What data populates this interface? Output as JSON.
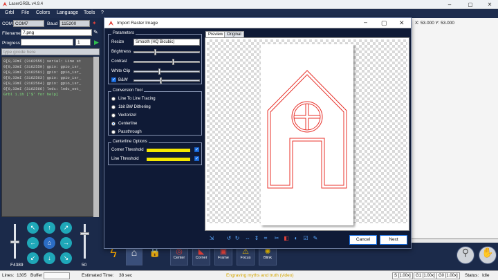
{
  "app": {
    "title": "LaserGRBL v4.9.4"
  },
  "window_buttons": {
    "minimize": "–",
    "maximize": "▢",
    "close": "✕"
  },
  "menu": [
    "Grbl",
    "File",
    "Colors",
    "Language",
    "Tools",
    "?"
  ],
  "connection": {
    "com_label": "COM",
    "com_value": "COM7",
    "baud_label": "Baud",
    "baud_value": "115200"
  },
  "file": {
    "filename_label": "Filename",
    "filename_value": "7.png",
    "progress_label": "Progress",
    "progress_value": "1"
  },
  "gcode_placeholder": "type gcode here",
  "console_lines": [
    "0[0,32mI (3162555) serial: Line st",
    "0[0,33mI (3162559) gpio: gpio_isr_",
    "0[0,33mI (3162561) gpio: gpio_isr_",
    "0[0,33mI (3162563) gpio: gpio_isr_",
    "0[0,33mI (3162564) gpio: gpio_isr_",
    "0[0,33mI (3162566) ledc: ledc_set_",
    "Grbl 1.1h ['$' for help]"
  ],
  "jog": {
    "speed_label": "F4389",
    "step_label": "50"
  },
  "coords": "X: 53.000 Y: 53.000",
  "dialog": {
    "title": "Import Raster Image",
    "tabs": [
      "Preview",
      "Original"
    ],
    "parameters": {
      "title": "Parameters",
      "resize_label": "Resize",
      "resize_value": "Smooth (HQ Bicubic)",
      "brightness_label": "Brightness",
      "brightness_level": 0.33,
      "contrast_label": "Contrast",
      "contrast_level": 0.6,
      "whiteclip_label": "White Clip",
      "whiteclip_level": 0.4,
      "bw_label": "B&W",
      "bw_level": 0.42
    },
    "conversion": {
      "title": "Conversion Tool",
      "options": [
        "Line To Line Tracing",
        "1bit BW Dithering",
        "Vectorize!",
        "Centerline",
        "Passthrough"
      ],
      "selected": 3
    },
    "centerline": {
      "title": "Centerline Options",
      "corner_label": "Corner Threshold",
      "corner_level": 0.95,
      "line_label": "Line Threshold",
      "line_level": 0.95
    },
    "cancel_label": "Cancel",
    "next_label": "Next",
    "line_color": "#e8312a"
  },
  "tools": [
    {
      "icon": "lightning-icon",
      "label": ""
    },
    {
      "icon": "home-icon",
      "label": ""
    },
    {
      "icon": "lock-icon",
      "label": ""
    },
    {
      "icon": "center-icon",
      "label": "Center"
    },
    {
      "icon": "corner-icon",
      "label": "Corner"
    },
    {
      "icon": "frame-icon",
      "label": "Frame"
    },
    {
      "icon": "focus-icon",
      "label": "Focus"
    },
    {
      "icon": "blink-icon",
      "label": "Blink"
    }
  ],
  "status": {
    "lines_label": "Lines:",
    "lines_value": "1305",
    "buffer_label": "Buffer",
    "est_label": "Estimated Time:",
    "est_value": "38 sec",
    "caption": "Engraving myths and truth (video)",
    "s_override": "S [1.00x]",
    "g1_override": "G1 [1.00x]",
    "g0_override": "G0 [1.00x]",
    "status_label": "Status:",
    "status_value": "Idle"
  },
  "colors": {
    "accent": "#1fa7b8",
    "bg": "#1b2a4a",
    "caption": "#f2d600"
  }
}
